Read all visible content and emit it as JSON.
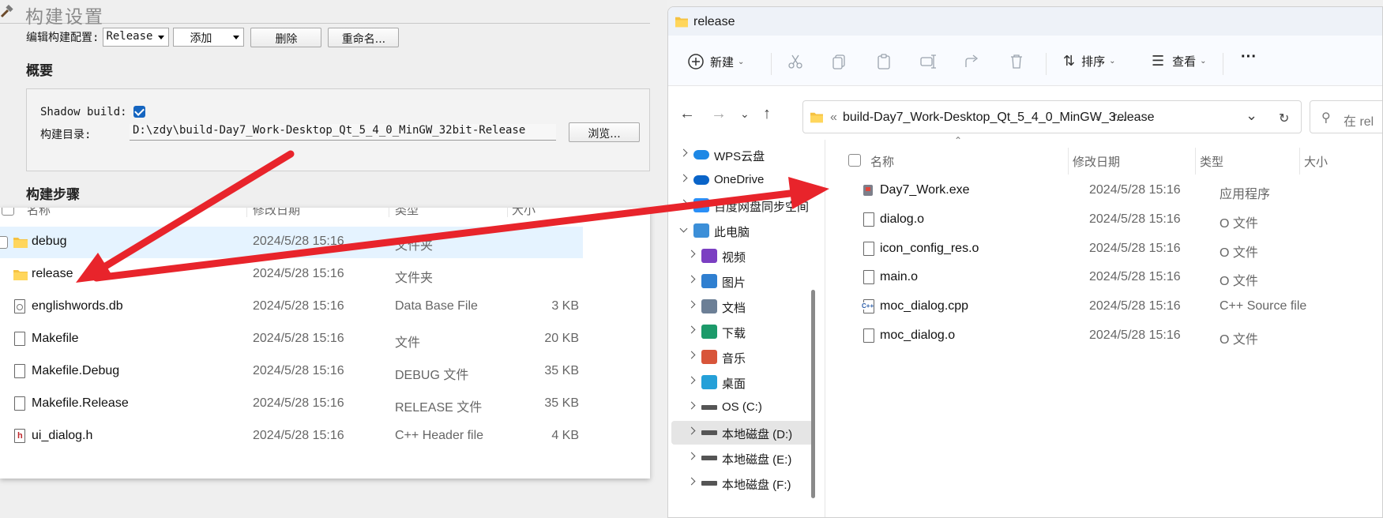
{
  "qt": {
    "title": "构建设置",
    "edit_config_label": "编辑构建配置:",
    "config_value": "Release",
    "add_label": "添加",
    "delete_label": "删除",
    "rename_label": "重命名...",
    "overview_heading": "概要",
    "shadow_build_label": "Shadow build:",
    "shadow_build_checked": true,
    "build_dir_label": "构建目录:",
    "build_dir_value": "D:\\zdy\\build-Day7_Work-Desktop_Qt_5_4_0_MinGW_32bit-Release",
    "browse_label": "浏览...",
    "steps_heading": "构建步骤"
  },
  "file_list": {
    "headers": [
      "名称",
      "修改日期",
      "类型",
      "大小"
    ],
    "rows": [
      {
        "name": "debug",
        "date": "2024/5/28 15:16",
        "type": "文件夹",
        "size": "",
        "icon": "folder-icon",
        "selected": true
      },
      {
        "name": "release",
        "date": "2024/5/28 15:16",
        "type": "文件夹",
        "size": "",
        "icon": "folder-icon",
        "selected": false
      },
      {
        "name": "englishwords.db",
        "date": "2024/5/28 15:16",
        "type": "Data Base File",
        "size": "3 KB",
        "icon": "database-file-icon",
        "selected": false
      },
      {
        "name": "Makefile",
        "date": "2024/5/28 15:16",
        "type": "文件",
        "size": "20 KB",
        "icon": "file-icon",
        "selected": false
      },
      {
        "name": "Makefile.Debug",
        "date": "2024/5/28 15:16",
        "type": "DEBUG 文件",
        "size": "35 KB",
        "icon": "file-icon",
        "selected": false
      },
      {
        "name": "Makefile.Release",
        "date": "2024/5/28 15:16",
        "type": "RELEASE 文件",
        "size": "35 KB",
        "icon": "file-icon",
        "selected": false
      },
      {
        "name": "ui_dialog.h",
        "date": "2024/5/28 15:16",
        "type": "C++ Header file",
        "size": "4 KB",
        "icon": "header-file-icon",
        "selected": false
      }
    ]
  },
  "explorer": {
    "title": "release",
    "toolbar": {
      "new_label": "新建",
      "sort_label": "排序",
      "view_label": "查看"
    },
    "address": {
      "prefix": "«",
      "path": "build-Day7_Work-Desktop_Qt_5_4_0_MinGW_3...",
      "current": "release"
    },
    "search_placeholder": "在 rel",
    "sidebar": [
      {
        "label": "WPS云盘",
        "icon": "cloud-icon",
        "color": "#1e88e5",
        "indent": 0,
        "expanded": false,
        "selected": false
      },
      {
        "label": "OneDrive",
        "icon": "onedrive-icon",
        "color": "#0a64c8",
        "indent": 0,
        "expanded": false,
        "selected": false
      },
      {
        "label": "百度网盘同步空间",
        "icon": "baidu-sync-icon",
        "color": "#2a8ff7",
        "indent": 0,
        "expanded": false,
        "selected": false
      },
      {
        "label": "此电脑",
        "icon": "computer-icon",
        "color": "#3c8fd8",
        "indent": 0,
        "expanded": true,
        "selected": false
      },
      {
        "label": "视频",
        "icon": "video-icon",
        "color": "#7b3fc2",
        "indent": 1,
        "expanded": false,
        "selected": false
      },
      {
        "label": "图片",
        "icon": "pictures-icon",
        "color": "#2f7fd0",
        "indent": 1,
        "expanded": false,
        "selected": false
      },
      {
        "label": "文档",
        "icon": "documents-icon",
        "color": "#6c7f96",
        "indent": 1,
        "expanded": false,
        "selected": false
      },
      {
        "label": "下载",
        "icon": "download-icon",
        "color": "#1c9a6a",
        "indent": 1,
        "expanded": false,
        "selected": false
      },
      {
        "label": "音乐",
        "icon": "music-icon",
        "color": "#d8553a",
        "indent": 1,
        "expanded": false,
        "selected": false
      },
      {
        "label": "桌面",
        "icon": "desktop-icon",
        "color": "#25a0d8",
        "indent": 1,
        "expanded": false,
        "selected": false
      },
      {
        "label": "OS (C:)",
        "icon": "drive-icon",
        "color": "#555555",
        "indent": 1,
        "expanded": false,
        "selected": false
      },
      {
        "label": "本地磁盘 (D:)",
        "icon": "drive-icon",
        "color": "#555555",
        "indent": 1,
        "expanded": false,
        "selected": true
      },
      {
        "label": "本地磁盘 (E:)",
        "icon": "drive-icon",
        "color": "#555555",
        "indent": 1,
        "expanded": false,
        "selected": false
      },
      {
        "label": "本地磁盘 (F:)",
        "icon": "drive-icon",
        "color": "#555555",
        "indent": 1,
        "expanded": false,
        "selected": false
      }
    ],
    "headers": [
      "名称",
      "修改日期",
      "类型",
      "大小"
    ],
    "rows": [
      {
        "name": "Day7_Work.exe",
        "date": "2024/5/28 15:16",
        "type": "应用程序",
        "icon": "exe-icon"
      },
      {
        "name": "dialog.o",
        "date": "2024/5/28 15:16",
        "type": "O 文件",
        "icon": "file-icon"
      },
      {
        "name": "icon_config_res.o",
        "date": "2024/5/28 15:16",
        "type": "O 文件",
        "icon": "file-icon"
      },
      {
        "name": "main.o",
        "date": "2024/5/28 15:16",
        "type": "O 文件",
        "icon": "file-icon"
      },
      {
        "name": "moc_dialog.cpp",
        "date": "2024/5/28 15:16",
        "type": "C++ Source file",
        "icon": "cpp-file-icon"
      },
      {
        "name": "moc_dialog.o",
        "date": "2024/5/28 15:16",
        "type": "O 文件",
        "icon": "file-icon"
      }
    ]
  },
  "colors": {
    "arrow": "#e8242b",
    "folder": "#f5c242",
    "accent": "#1565c0"
  }
}
